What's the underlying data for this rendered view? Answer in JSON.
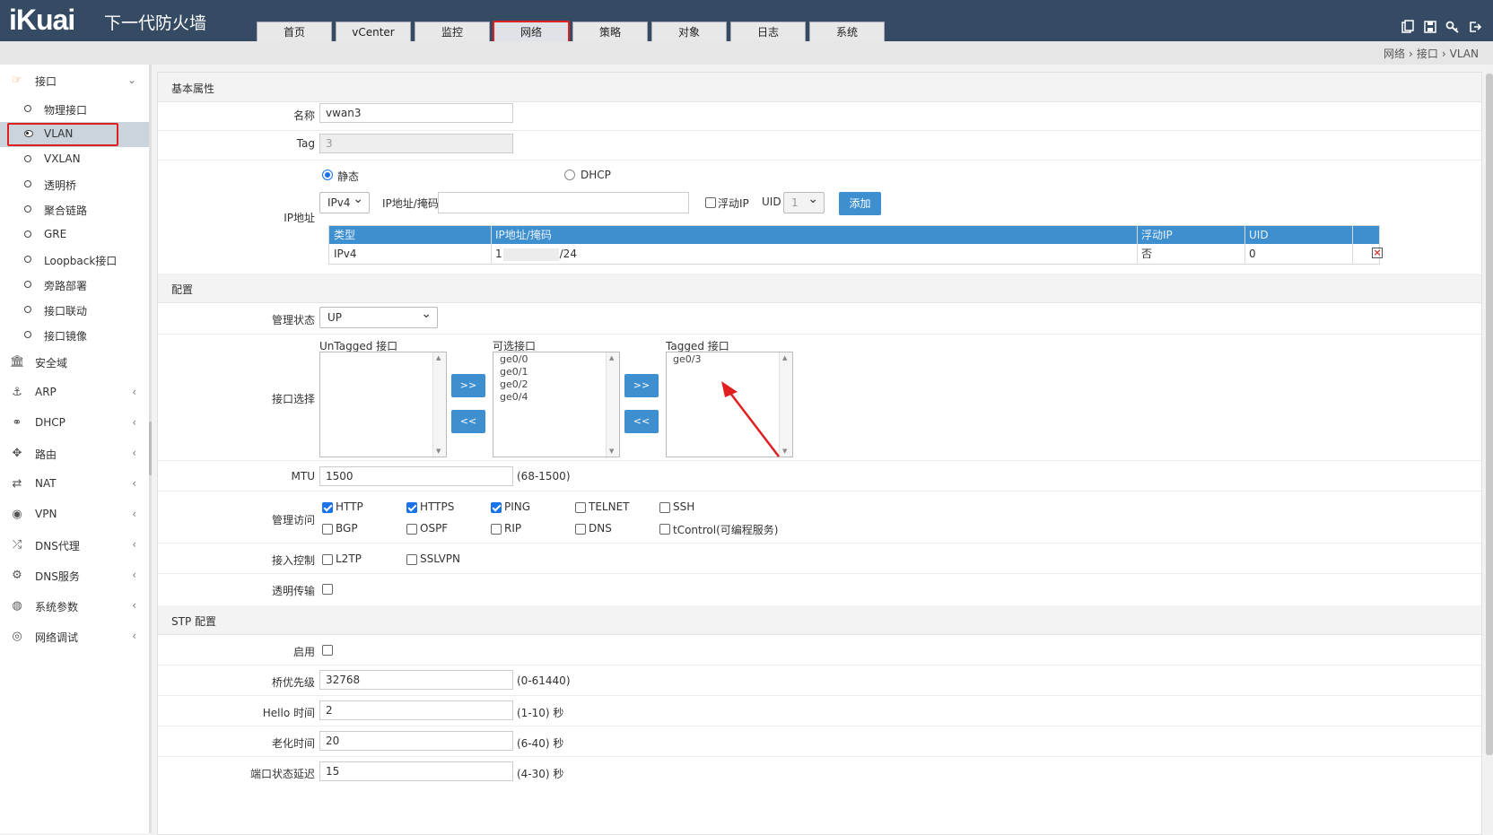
{
  "header": {
    "logo": "iKuai",
    "product": "下一代防火墙",
    "tabs": [
      "首页",
      "vCenter",
      "监控",
      "网络",
      "策略",
      "对象",
      "日志",
      "系统"
    ],
    "active_tab": "网络",
    "icons": [
      "vlan-icon",
      "save-icon",
      "key-icon",
      "logout-icon"
    ]
  },
  "breadcrumb": [
    "网络",
    "接口",
    "VLAN"
  ],
  "sidebar": {
    "interface_group": "接口",
    "interface_items": [
      "物理接口",
      "VLAN",
      "VXLAN",
      "透明桥",
      "聚合链路",
      "GRE",
      "Loopback接口",
      "旁路部署",
      "接口联动",
      "接口镜像"
    ],
    "active_item": "VLAN",
    "groups": [
      "安全域",
      "ARP",
      "DHCP",
      "路由",
      "NAT",
      "VPN",
      "DNS代理",
      "DNS服务",
      "系统参数",
      "网络调试"
    ]
  },
  "basic": {
    "section_title": "基本属性",
    "name_label": "名称",
    "name_value": "vwan3",
    "tag_label": "Tag",
    "tag_value": "3",
    "ip_label": "IP地址",
    "mode_static": "静态",
    "mode_dhcp": "DHCP",
    "ip_version": "IPv4",
    "ip_mask_label": "IP地址/掩码",
    "float_ip_label": "浮动IP",
    "uid_label": "UID",
    "uid_value": "1",
    "add_button": "添加",
    "table_headers": [
      "类型",
      "IP地址/掩码",
      "浮动IP",
      "UID"
    ],
    "table_row": {
      "type": "IPv4",
      "ip_prefix": "1",
      "ip_suffix": "/24",
      "float_ip": "否",
      "uid": "0"
    }
  },
  "config": {
    "section_title": "配置",
    "admin_state_label": "管理状态",
    "admin_state_value": "UP",
    "iface_select_label": "接口选择",
    "untagged_label": "UnTagged 接口",
    "available_label": "可选接口",
    "tagged_label": "Tagged 接口",
    "untagged_items": [],
    "available_items": [
      "ge0/0",
      "ge0/1",
      "ge0/2",
      "ge0/4"
    ],
    "tagged_items": [
      "ge0/3"
    ],
    "move_right": ">>",
    "move_left": "<<",
    "mtu_label": "MTU",
    "mtu_value": "1500",
    "mtu_hint": "(68-1500)",
    "mgmt_label": "管理访问",
    "mgmt_options": [
      {
        "label": "HTTP",
        "checked": true
      },
      {
        "label": "HTTPS",
        "checked": true
      },
      {
        "label": "PING",
        "checked": true
      },
      {
        "label": "TELNET",
        "checked": false
      },
      {
        "label": "SSH",
        "checked": false
      },
      {
        "label": "BGP",
        "checked": false
      },
      {
        "label": "OSPF",
        "checked": false
      },
      {
        "label": "RIP",
        "checked": false
      },
      {
        "label": "DNS",
        "checked": false
      },
      {
        "label": "tControl(可编程服务)",
        "checked": false
      }
    ],
    "access_label": "接入控制",
    "access_options": [
      {
        "label": "L2TP",
        "checked": false
      },
      {
        "label": "SSLVPN",
        "checked": false
      }
    ],
    "transparent_label": "透明传输"
  },
  "stp": {
    "section_title": "STP 配置",
    "enable_label": "启用",
    "priority_label": "桥优先级",
    "priority_value": "32768",
    "priority_hint": "(0-61440)",
    "hello_label": "Hello 时间",
    "hello_value": "2",
    "hello_hint": "(1-10) 秒",
    "aging_label": "老化时间",
    "aging_value": "20",
    "aging_hint": "(6-40) 秒",
    "delay_label": "端口状态延迟",
    "delay_value": "15",
    "delay_hint": "(4-30) 秒"
  },
  "colors": {
    "header": "#354a63",
    "accent": "#3e8fd0",
    "highlight": "#e02020"
  }
}
